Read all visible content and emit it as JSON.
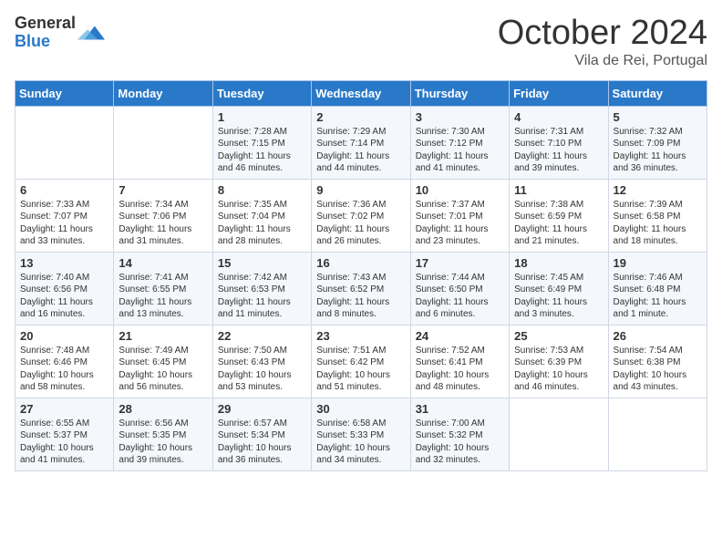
{
  "logo": {
    "general": "General",
    "blue": "Blue"
  },
  "header": {
    "month": "October 2024",
    "location": "Vila de Rei, Portugal"
  },
  "weekdays": [
    "Sunday",
    "Monday",
    "Tuesday",
    "Wednesday",
    "Thursday",
    "Friday",
    "Saturday"
  ],
  "weeks": [
    [
      {
        "day": "",
        "info": ""
      },
      {
        "day": "",
        "info": ""
      },
      {
        "day": "1",
        "info": "Sunrise: 7:28 AM\nSunset: 7:15 PM\nDaylight: 11 hours and 46 minutes."
      },
      {
        "day": "2",
        "info": "Sunrise: 7:29 AM\nSunset: 7:14 PM\nDaylight: 11 hours and 44 minutes."
      },
      {
        "day": "3",
        "info": "Sunrise: 7:30 AM\nSunset: 7:12 PM\nDaylight: 11 hours and 41 minutes."
      },
      {
        "day": "4",
        "info": "Sunrise: 7:31 AM\nSunset: 7:10 PM\nDaylight: 11 hours and 39 minutes."
      },
      {
        "day": "5",
        "info": "Sunrise: 7:32 AM\nSunset: 7:09 PM\nDaylight: 11 hours and 36 minutes."
      }
    ],
    [
      {
        "day": "6",
        "info": "Sunrise: 7:33 AM\nSunset: 7:07 PM\nDaylight: 11 hours and 33 minutes."
      },
      {
        "day": "7",
        "info": "Sunrise: 7:34 AM\nSunset: 7:06 PM\nDaylight: 11 hours and 31 minutes."
      },
      {
        "day": "8",
        "info": "Sunrise: 7:35 AM\nSunset: 7:04 PM\nDaylight: 11 hours and 28 minutes."
      },
      {
        "day": "9",
        "info": "Sunrise: 7:36 AM\nSunset: 7:02 PM\nDaylight: 11 hours and 26 minutes."
      },
      {
        "day": "10",
        "info": "Sunrise: 7:37 AM\nSunset: 7:01 PM\nDaylight: 11 hours and 23 minutes."
      },
      {
        "day": "11",
        "info": "Sunrise: 7:38 AM\nSunset: 6:59 PM\nDaylight: 11 hours and 21 minutes."
      },
      {
        "day": "12",
        "info": "Sunrise: 7:39 AM\nSunset: 6:58 PM\nDaylight: 11 hours and 18 minutes."
      }
    ],
    [
      {
        "day": "13",
        "info": "Sunrise: 7:40 AM\nSunset: 6:56 PM\nDaylight: 11 hours and 16 minutes."
      },
      {
        "day": "14",
        "info": "Sunrise: 7:41 AM\nSunset: 6:55 PM\nDaylight: 11 hours and 13 minutes."
      },
      {
        "day": "15",
        "info": "Sunrise: 7:42 AM\nSunset: 6:53 PM\nDaylight: 11 hours and 11 minutes."
      },
      {
        "day": "16",
        "info": "Sunrise: 7:43 AM\nSunset: 6:52 PM\nDaylight: 11 hours and 8 minutes."
      },
      {
        "day": "17",
        "info": "Sunrise: 7:44 AM\nSunset: 6:50 PM\nDaylight: 11 hours and 6 minutes."
      },
      {
        "day": "18",
        "info": "Sunrise: 7:45 AM\nSunset: 6:49 PM\nDaylight: 11 hours and 3 minutes."
      },
      {
        "day": "19",
        "info": "Sunrise: 7:46 AM\nSunset: 6:48 PM\nDaylight: 11 hours and 1 minute."
      }
    ],
    [
      {
        "day": "20",
        "info": "Sunrise: 7:48 AM\nSunset: 6:46 PM\nDaylight: 10 hours and 58 minutes."
      },
      {
        "day": "21",
        "info": "Sunrise: 7:49 AM\nSunset: 6:45 PM\nDaylight: 10 hours and 56 minutes."
      },
      {
        "day": "22",
        "info": "Sunrise: 7:50 AM\nSunset: 6:43 PM\nDaylight: 10 hours and 53 minutes."
      },
      {
        "day": "23",
        "info": "Sunrise: 7:51 AM\nSunset: 6:42 PM\nDaylight: 10 hours and 51 minutes."
      },
      {
        "day": "24",
        "info": "Sunrise: 7:52 AM\nSunset: 6:41 PM\nDaylight: 10 hours and 48 minutes."
      },
      {
        "day": "25",
        "info": "Sunrise: 7:53 AM\nSunset: 6:39 PM\nDaylight: 10 hours and 46 minutes."
      },
      {
        "day": "26",
        "info": "Sunrise: 7:54 AM\nSunset: 6:38 PM\nDaylight: 10 hours and 43 minutes."
      }
    ],
    [
      {
        "day": "27",
        "info": "Sunrise: 6:55 AM\nSunset: 5:37 PM\nDaylight: 10 hours and 41 minutes."
      },
      {
        "day": "28",
        "info": "Sunrise: 6:56 AM\nSunset: 5:35 PM\nDaylight: 10 hours and 39 minutes."
      },
      {
        "day": "29",
        "info": "Sunrise: 6:57 AM\nSunset: 5:34 PM\nDaylight: 10 hours and 36 minutes."
      },
      {
        "day": "30",
        "info": "Sunrise: 6:58 AM\nSunset: 5:33 PM\nDaylight: 10 hours and 34 minutes."
      },
      {
        "day": "31",
        "info": "Sunrise: 7:00 AM\nSunset: 5:32 PM\nDaylight: 10 hours and 32 minutes."
      },
      {
        "day": "",
        "info": ""
      },
      {
        "day": "",
        "info": ""
      }
    ]
  ]
}
